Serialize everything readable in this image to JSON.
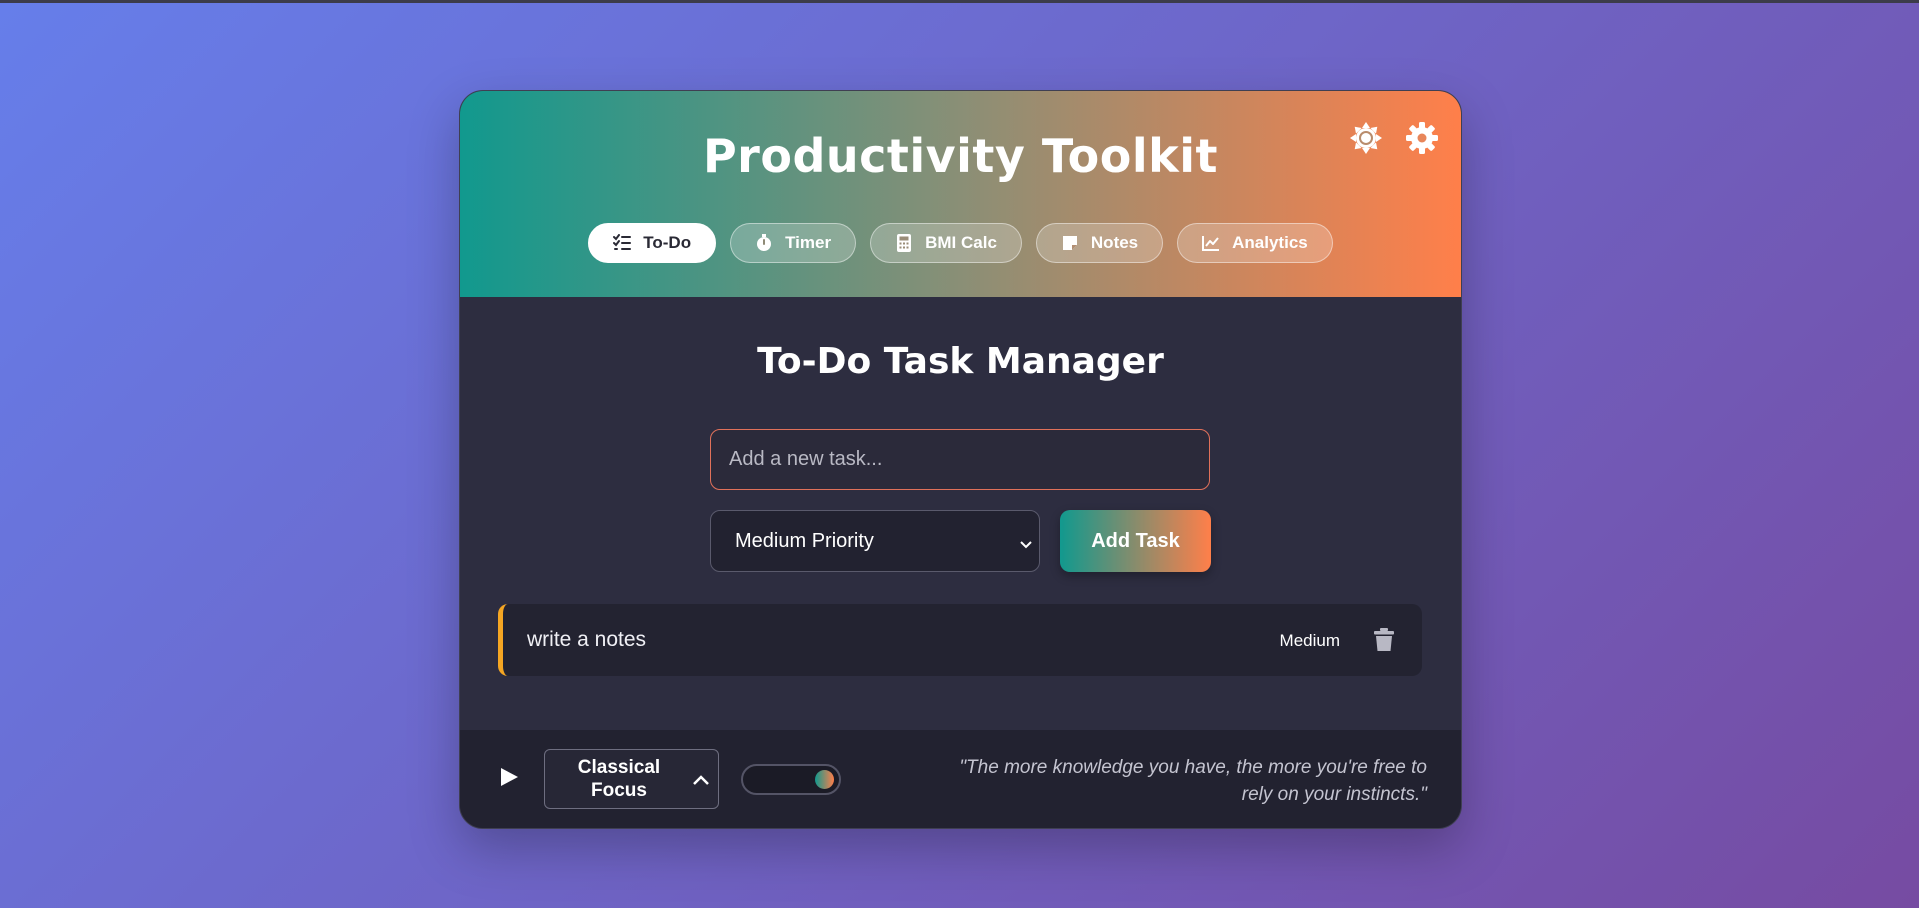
{
  "app": {
    "title": "Productivity Toolkit",
    "icons": [
      "brightness-icon",
      "gear-icon"
    ]
  },
  "tabs": [
    {
      "label": "To-Do",
      "icon": "checklist-icon",
      "active": true
    },
    {
      "label": "Timer",
      "icon": "stopwatch-icon",
      "active": false
    },
    {
      "label": "BMI Calc",
      "icon": "calculator-icon",
      "active": false
    },
    {
      "label": "Notes",
      "icon": "sticky-note-icon",
      "active": false
    },
    {
      "label": "Analytics",
      "icon": "chart-line-icon",
      "active": false
    }
  ],
  "todo": {
    "title": "To-Do Task Manager",
    "input_placeholder": "Add a new task...",
    "input_value": "",
    "priority_selected": "Medium Priority",
    "add_button_label": "Add Task",
    "tasks": [
      {
        "text": "write a notes",
        "priority": "Medium",
        "priority_color": "#f5a623"
      }
    ]
  },
  "footer": {
    "music_selected": "Classical Focus",
    "quote": "\"The more knowledge you have, the more you're free to rely on your instincts.\""
  },
  "colors": {
    "background_start": "#667eea",
    "background_end": "#764ba2",
    "accent_start": "#11998e",
    "accent_end": "#ff7f4a",
    "panel": "#2d2d40"
  }
}
